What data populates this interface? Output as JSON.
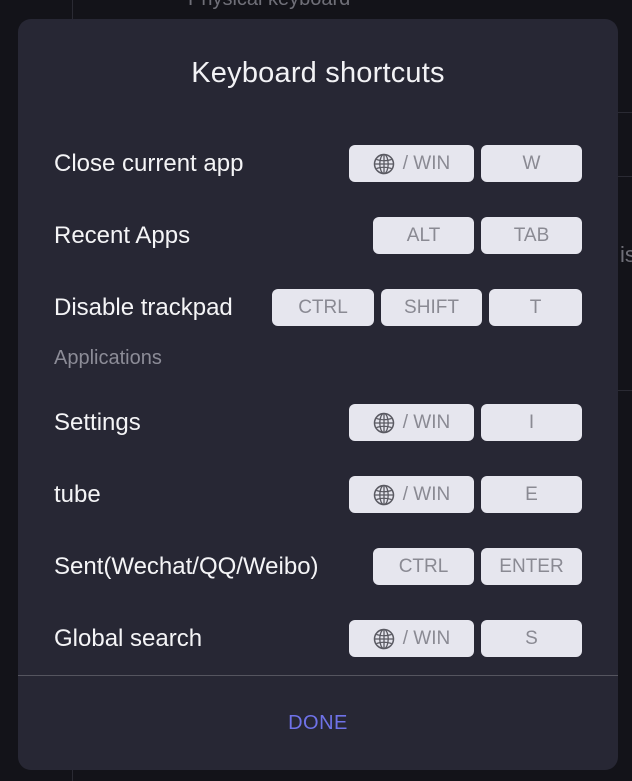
{
  "background": {
    "peek_top_text": "Physical keyboard",
    "peek_side_text": "is"
  },
  "dialog": {
    "title": "Keyboard shortcuts",
    "done_label": "DONE",
    "accent_color": "#6f72e8"
  },
  "shortcuts": [
    {
      "label": "Close current app",
      "keys": [
        "/ WIN",
        "W"
      ],
      "globe": true
    },
    {
      "label": "Recent Apps",
      "keys": [
        "ALT",
        "TAB"
      ],
      "globe": false
    },
    {
      "label": "Disable trackpad",
      "keys": [
        "CTRL",
        "SHIFT",
        "T"
      ],
      "globe": false
    }
  ],
  "applications": {
    "section_title": "Applications",
    "items": [
      {
        "label": "Settings",
        "keys": [
          "/ WIN",
          "I"
        ],
        "globe": true
      },
      {
        "label": "tube",
        "keys": [
          "/ WIN",
          "E"
        ],
        "globe": true
      },
      {
        "label": "Sent(Wechat/QQ/Weibo)",
        "keys": [
          "CTRL",
          "ENTER"
        ],
        "globe": false
      },
      {
        "label": "Global search",
        "keys": [
          "/ WIN",
          "S"
        ],
        "globe": true
      }
    ]
  },
  "icons": {
    "globe": "globe-icon"
  }
}
